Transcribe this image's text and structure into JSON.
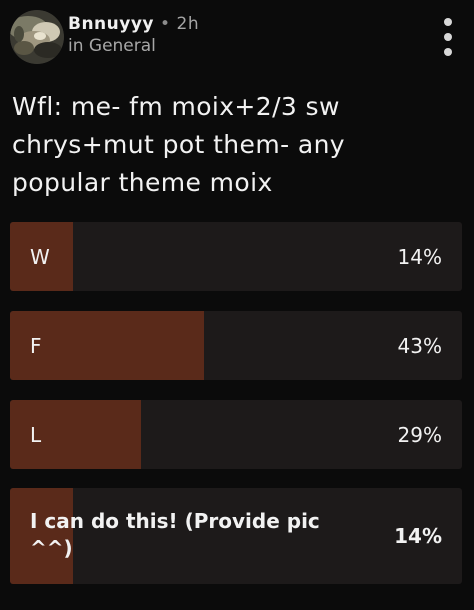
{
  "post": {
    "author": "Bnnuyyy",
    "separator": "•",
    "time_ago": "2h",
    "community": "in General",
    "title": "Wfl: me- fm moix+2/3 sw chrys+mut pot them- any popular theme moix"
  },
  "poll": {
    "options": [
      {
        "label": "W",
        "percent_text": "14%",
        "percent": 14
      },
      {
        "label": "F",
        "percent_text": "43%",
        "percent": 43
      },
      {
        "label": "L",
        "percent_text": "29%",
        "percent": 29
      },
      {
        "label": "I can do this! (Provide pic ^^)",
        "percent_text": "14%",
        "percent": 14
      }
    ]
  },
  "colors": {
    "background": "#0b0b0b",
    "option_track": "#1d1a1a",
    "option_fill": "#5a2a1a",
    "text": "#f2f2f2",
    "muted_text": "#a7a7a7"
  },
  "icons": {
    "more": "vertical-ellipsis-icon"
  }
}
